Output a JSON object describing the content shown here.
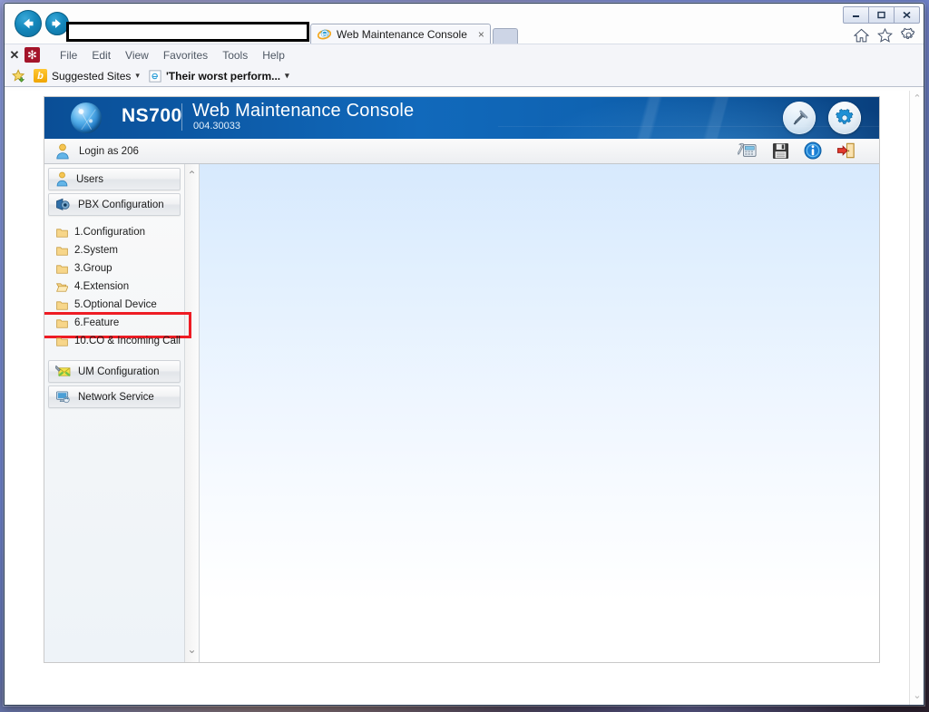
{
  "browser": {
    "window_controls": {
      "minimize": "minimize-button",
      "restore": "restore-button",
      "close": "close-button"
    },
    "address_value": "",
    "address_placeholder": "",
    "back_label": "Back",
    "forward_label": "Forward",
    "tabs": [
      {
        "title": "Web Maintenance Console",
        "close": "×",
        "active": true
      }
    ],
    "new_tab_label": "",
    "toolbar_icons": [
      "home-icon",
      "favorites-icon",
      "tools-icon"
    ],
    "command_close_label": "✕",
    "addon_label": "✻",
    "menu": [
      "File",
      "Edit",
      "View",
      "Favorites",
      "Tools",
      "Help"
    ],
    "favorites": [
      {
        "label": "Suggested Sites",
        "icon": "bing-icon",
        "caret": "▾",
        "bold": false
      },
      {
        "label": "'Their worst perform...",
        "icon": "ie-icon",
        "caret": "▾",
        "bold": true
      }
    ],
    "scroll_up": "⌃",
    "scroll_down": "⌄"
  },
  "app": {
    "banner": {
      "brand": "NS700",
      "title": "Web Maintenance Console",
      "version": "004.30033",
      "buttons": [
        "maintenance-hammer-button",
        "settings-gear-button"
      ]
    },
    "loginbar": {
      "login_text": "Login as 206",
      "tools": [
        "phone-device-icon",
        "save-icon",
        "information-icon",
        "logout-icon"
      ]
    },
    "sidebar": {
      "groups": [
        {
          "label": "Users",
          "icon": "user-icon",
          "type": "header"
        },
        {
          "label": "PBX Configuration",
          "icon": "pbx-icon",
          "type": "header",
          "expanded": true
        }
      ],
      "tree_items": [
        {
          "label": "1.Configuration",
          "icon": "folder-closed-icon",
          "highlighted": false
        },
        {
          "label": "2.System",
          "icon": "folder-closed-icon",
          "highlighted": false
        },
        {
          "label": "3.Group",
          "icon": "folder-closed-icon",
          "highlighted": false
        },
        {
          "label": "4.Extension",
          "icon": "folder-open-icon",
          "highlighted": false
        },
        {
          "label": "5.Optional Device",
          "icon": "folder-closed-icon",
          "highlighted": false
        },
        {
          "label": "6.Feature",
          "icon": "folder-closed-icon",
          "highlighted": true
        },
        {
          "label": "10.CO & Incoming Call",
          "icon": "folder-closed-icon",
          "highlighted": false
        }
      ],
      "footer_groups": [
        {
          "label": "UM Configuration",
          "icon": "um-icon",
          "type": "header"
        },
        {
          "label": "Network Service",
          "icon": "network-icon",
          "type": "header"
        }
      ],
      "scroll_up": "⌃",
      "scroll_down": "⌄"
    },
    "colors": {
      "banner_blue": "#0d5ba8",
      "highlight_red": "#ee1c24",
      "content_blue": "#d7e9fd"
    }
  }
}
